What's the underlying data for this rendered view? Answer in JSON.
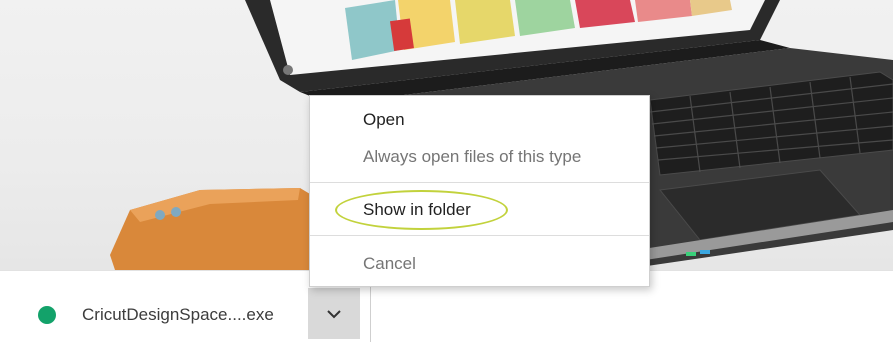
{
  "download_item": {
    "filename": "CricutDesignSpace....exe",
    "status_color": "#13a26a",
    "menu_button_icon": "chevron-down-icon"
  },
  "context_menu": {
    "items": [
      {
        "label": "Open",
        "enabled": true
      },
      {
        "label": "Always open files of this type",
        "enabled": false
      },
      {
        "label": "Show in folder",
        "enabled": true,
        "highlighted": true
      },
      {
        "label": "Cancel",
        "enabled": false
      }
    ]
  },
  "colors": {
    "highlight_ring": "#c2d23c",
    "shelf_button": "#d9d9d9"
  }
}
